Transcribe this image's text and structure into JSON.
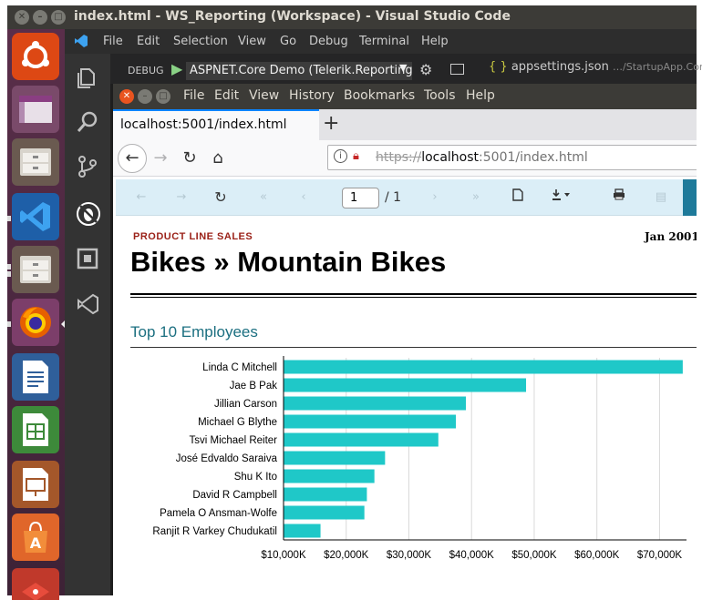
{
  "vscode": {
    "window_title": "index.html - WS_Reporting (Workspace) - Visual Studio Code",
    "menu": [
      "File",
      "Edit",
      "Selection",
      "View",
      "Go",
      "Debug",
      "Terminal",
      "Help"
    ],
    "debug_label": "DEBUG",
    "debug_config": "ASPNET.Core Demo (Telerik.Reporting",
    "tab_file": "appsettings.json",
    "tab_path": "…/StartupApp.Core",
    "tab_icon": "{ }"
  },
  "firefox": {
    "menu": [
      "File",
      "Edit",
      "View",
      "History",
      "Bookmarks",
      "Tools",
      "Help"
    ],
    "tab_title": "localhost:5001/index.html",
    "url_scheme": "https://",
    "url_host": "localhost",
    "url_rest": ":5001/index.html"
  },
  "viewer": {
    "page_current": "1",
    "page_total": "/ 1"
  },
  "report": {
    "kicker": "PRODUCT LINE SALES",
    "date": "Jan 2001",
    "title": "Bikes » Mountain Bikes",
    "subtitle": "Top 10 Employees"
  },
  "chart_data": {
    "type": "bar",
    "orientation": "horizontal",
    "categories": [
      "Linda C Mitchell",
      "Jae B Pak",
      "Jillian  Carson",
      "Michael G Blythe",
      "Tsvi Michael Reiter",
      "José Edvaldo Saraiva",
      "Shu K Ito",
      "David R Campbell",
      "Pamela O Ansman-Wolfe",
      "Ranjit R Varkey Chudukatil"
    ],
    "values": [
      73700,
      48700,
      39100,
      37500,
      34700,
      26200,
      24500,
      23300,
      22900,
      15900
    ],
    "tick_labels": [
      "$10,000K",
      "$20,000K",
      "$30,000K",
      "$40,000K",
      "$50,000K",
      "$60,000K",
      "$70,000K"
    ],
    "tick_values": [
      10000,
      20000,
      30000,
      40000,
      50000,
      60000,
      70000
    ],
    "xlim": [
      10000,
      74300
    ],
    "grid": true,
    "bar_color": "#1fc8c8"
  },
  "colors": {
    "accent_link": "#1b6f80",
    "kicker": "#9b2219",
    "toolbar_bg": "#dbeef7"
  }
}
